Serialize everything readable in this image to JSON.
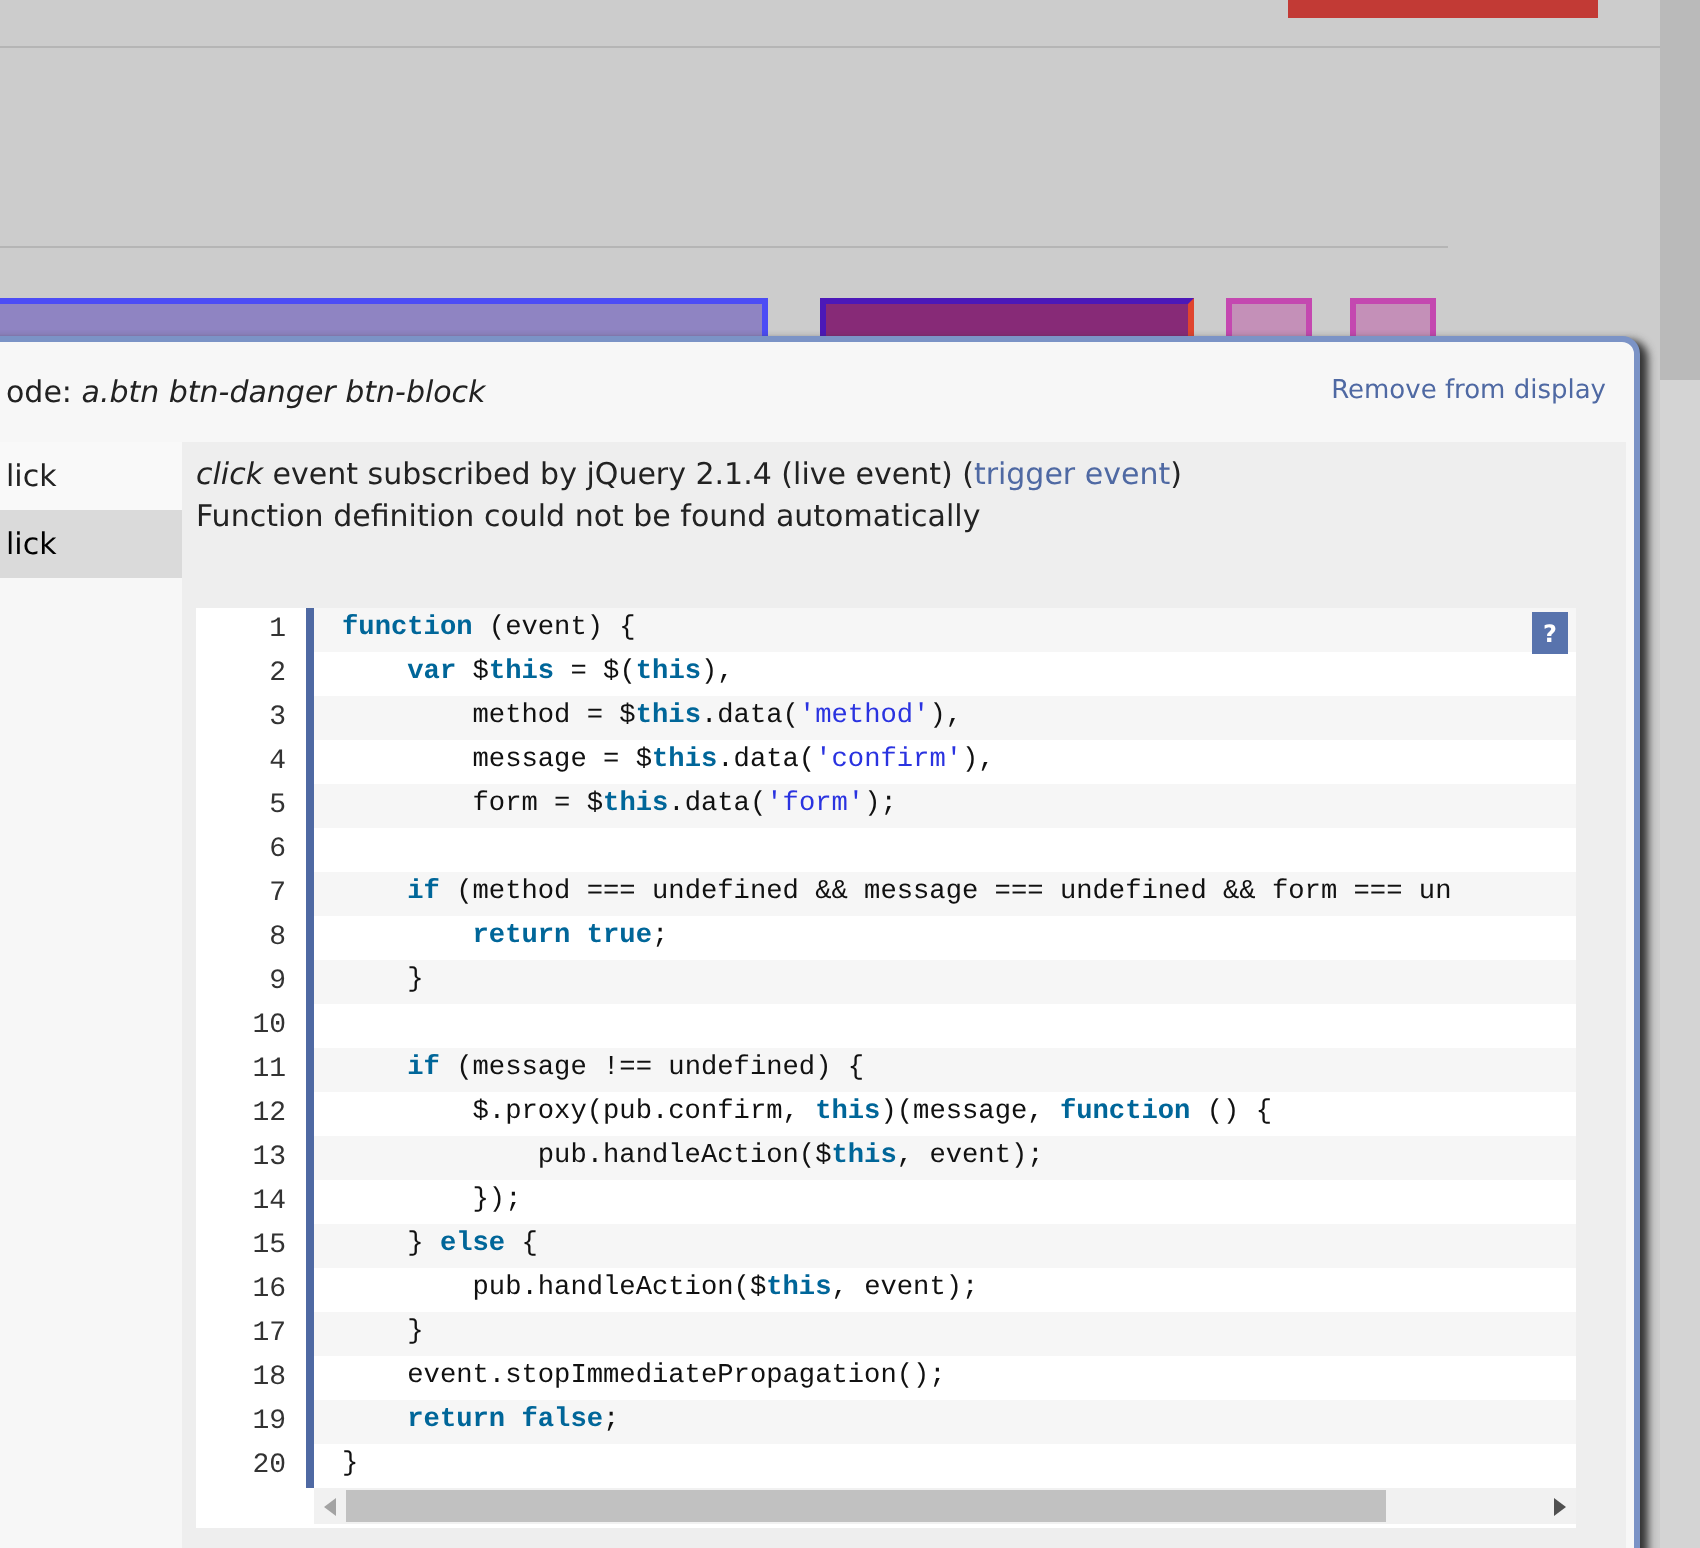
{
  "panel": {
    "node_label": "ode: *a.btn btn-danger btn-block*",
    "remove_link": "Remove from display"
  },
  "events": [
    {
      "label": "lick",
      "selected": false
    },
    {
      "label": "lick",
      "selected": true
    }
  ],
  "event_info": {
    "prefix": "*click* event subscribed by jQuery 2.1.4 (live event) (",
    "link": "trigger event",
    "suffix": ")",
    "note": "Function definition could not be found automatically"
  },
  "code": {
    "help": "?",
    "lines": [
      {
        "number": "1",
        "tokens": [
          {
            "kind": "keyword",
            "text": "function"
          },
          {
            "kind": "plain",
            "text": " (event) {"
          }
        ]
      },
      {
        "number": "2",
        "tokens": [
          {
            "kind": "keyword",
            "text": "    var"
          },
          {
            "kind": "plain",
            "text": " $"
          },
          {
            "kind": "keyword",
            "text": "this"
          },
          {
            "kind": "plain",
            "text": " = $("
          },
          {
            "kind": "keyword",
            "text": "this"
          },
          {
            "kind": "plain",
            "text": "),"
          }
        ]
      },
      {
        "number": "3",
        "tokens": [
          {
            "kind": "plain",
            "text": "        method = $"
          },
          {
            "kind": "keyword",
            "text": "this"
          },
          {
            "kind": "plain",
            "text": ".data("
          },
          {
            "kind": "string",
            "text": "'method'"
          },
          {
            "kind": "plain",
            "text": "),"
          }
        ]
      },
      {
        "number": "4",
        "tokens": [
          {
            "kind": "plain",
            "text": "        message = $"
          },
          {
            "kind": "keyword",
            "text": "this"
          },
          {
            "kind": "plain",
            "text": ".data("
          },
          {
            "kind": "string",
            "text": "'confirm'"
          },
          {
            "kind": "plain",
            "text": "),"
          }
        ]
      },
      {
        "number": "5",
        "tokens": [
          {
            "kind": "plain",
            "text": "        form = $"
          },
          {
            "kind": "keyword",
            "text": "this"
          },
          {
            "kind": "plain",
            "text": ".data("
          },
          {
            "kind": "string",
            "text": "'form'"
          },
          {
            "kind": "plain",
            "text": ");"
          }
        ]
      },
      {
        "number": "6"
      },
      {
        "number": "7",
        "tokens": [
          {
            "kind": "keyword",
            "text": "    if"
          },
          {
            "kind": "plain",
            "text": " (method === undefined && message === undefined && form === un"
          }
        ]
      },
      {
        "number": "8",
        "tokens": [
          {
            "kind": "keyword",
            "text": "        return true"
          },
          {
            "kind": "plain",
            "text": ";"
          }
        ]
      },
      {
        "number": "9",
        "tokens": [
          {
            "kind": "plain",
            "text": "    }"
          }
        ]
      },
      {
        "number": "10"
      },
      {
        "number": "11",
        "tokens": [
          {
            "kind": "keyword",
            "text": "    if"
          },
          {
            "kind": "plain",
            "text": " (message !== undefined) {"
          }
        ]
      },
      {
        "number": "12",
        "tokens": [
          {
            "kind": "plain",
            "text": "        $.proxy(pub.confirm, "
          },
          {
            "kind": "keyword",
            "text": "this"
          },
          {
            "kind": "plain",
            "text": ")(message, "
          },
          {
            "kind": "keyword",
            "text": "function"
          },
          {
            "kind": "plain",
            "text": " () {"
          }
        ]
      },
      {
        "number": "13",
        "tokens": [
          {
            "kind": "plain",
            "text": "            pub.handleAction($"
          },
          {
            "kind": "keyword",
            "text": "this"
          },
          {
            "kind": "plain",
            "text": ", event);"
          }
        ]
      },
      {
        "number": "14",
        "tokens": [
          {
            "kind": "plain",
            "text": "        });"
          }
        ]
      },
      {
        "number": "15",
        "tokens": [
          {
            "kind": "plain",
            "text": "    } "
          },
          {
            "kind": "keyword",
            "text": "else"
          },
          {
            "kind": "plain",
            "text": " {"
          }
        ]
      },
      {
        "number": "16",
        "tokens": [
          {
            "kind": "plain",
            "text": "        pub.handleAction($"
          },
          {
            "kind": "keyword",
            "text": "this"
          },
          {
            "kind": "plain",
            "text": ", event);"
          }
        ]
      },
      {
        "number": "17",
        "tokens": [
          {
            "kind": "plain",
            "text": "    }"
          }
        ]
      },
      {
        "number": "18",
        "tokens": [
          {
            "kind": "plain",
            "text": "    event.stopImmediatePropagation();"
          }
        ]
      },
      {
        "number": "19",
        "tokens": [
          {
            "kind": "keyword",
            "text": "    return false"
          },
          {
            "kind": "plain",
            "text": ";"
          }
        ]
      },
      {
        "number": "20",
        "tokens": [
          {
            "kind": "plain",
            "text": "}"
          }
        ]
      }
    ]
  }
}
